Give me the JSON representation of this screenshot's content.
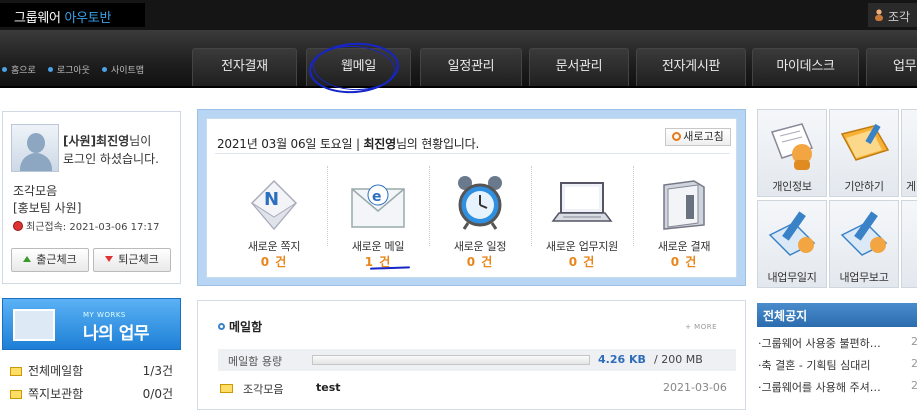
{
  "header": {
    "logo_main": "그룹웨어 ",
    "logo_hi": "아우토반",
    "user_partial": "조각"
  },
  "nav": {
    "links": [
      "홈으로",
      "로그아웃",
      "사이트맵"
    ],
    "tabs": [
      "전자결재",
      "웹메일",
      "일정관리",
      "문서관리",
      "전자게시판",
      "마이데스크",
      "업무"
    ]
  },
  "profile": {
    "rank_name": "[사원]최진영",
    "suffix1": "님이",
    "line2": "로그인 하셨습니다.",
    "group": "조각모음",
    "team": "[홍보팀 사원]",
    "last_login": "최근접속: 2021-03-06 17:17",
    "checkin_label": "출근체크",
    "checkout_label": "퇴근체크"
  },
  "mywork": {
    "small": "MY WORKS",
    "title": "나의 업무",
    "items": [
      {
        "label": "전체메일함",
        "count": "1/3건"
      },
      {
        "label": "쪽지보관함",
        "count": "0/0건"
      }
    ]
  },
  "status": {
    "date_text": "2021년 03월 06일 토요일 | ",
    "name": "최진영",
    "date_suffix": "님의 현황입니다.",
    "refresh_label": "새로고침",
    "items": [
      {
        "label": "새로운 쪽지",
        "value": "0 건"
      },
      {
        "label": "새로운 메일",
        "value": "1 건"
      },
      {
        "label": "새로운 일정",
        "value": "0 건"
      },
      {
        "label": "새로운 업무지원",
        "value": "0 건"
      },
      {
        "label": "새로운 결재",
        "value": "0 건"
      }
    ]
  },
  "mailbox": {
    "title": "메일함",
    "more": "+ MORE",
    "quota_label": "메일함 용량",
    "used": "4.26 KB",
    "sep": "/",
    "total": "200 MB",
    "row": {
      "from": "조각모음",
      "subject": "test",
      "date": "2021-03-06"
    }
  },
  "quick": {
    "items": [
      "개인정보",
      "기안하기",
      "게",
      "내업무일지",
      "내업무보고"
    ]
  },
  "notice": {
    "title": "전체공지",
    "items": [
      {
        "text": "·그룹웨어 사용중 불편하…",
        "n": "2"
      },
      {
        "text": "·축 결혼 - 기획팀 심대리",
        "n": "2"
      },
      {
        "text": "·그룹웨어를 사용해 주셔…",
        "n": "2"
      }
    ]
  }
}
